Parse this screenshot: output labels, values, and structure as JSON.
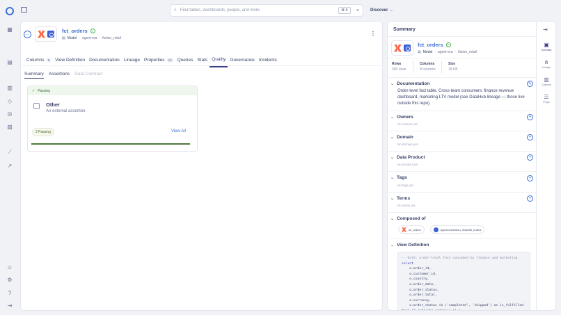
{
  "search": {
    "placeholder": "Find tables, dashboards, people, and more",
    "shortcut": "⌘ K"
  },
  "nav": {
    "discover": "Discover →"
  },
  "entity": {
    "name": "fct_orders",
    "type": "Model",
    "path": [
      "agent-era",
      "fiction_retail"
    ]
  },
  "tabs": [
    {
      "label": "Columns",
      "count": "9"
    },
    {
      "label": "View Definition"
    },
    {
      "label": "Documentation"
    },
    {
      "label": "Lineage"
    },
    {
      "label": "Properties",
      "count": "12"
    },
    {
      "label": "Queries"
    },
    {
      "label": "Stats"
    },
    {
      "label": "Quality"
    },
    {
      "label": "Governance"
    },
    {
      "label": "Incidents"
    }
  ],
  "active_tab": "Quality",
  "subtabs": [
    "Summary",
    "Assertions",
    "Data Contract"
  ],
  "quality": {
    "status": "Passing",
    "group_title": "Other",
    "group_desc": "An external assertion.",
    "badge": "2 Passing",
    "view_all": "View All",
    "progress": 1.0
  },
  "summary": {
    "title": "Summary",
    "entity_name": "fct_orders",
    "entity_type": "Model",
    "path": [
      "agent-era",
      "fiction_retail"
    ],
    "stats": [
      {
        "label": "Rows",
        "value": "300 rows"
      },
      {
        "label": "Columns",
        "value": "8 columns"
      },
      {
        "label": "Size",
        "value": "18 KB"
      }
    ],
    "documentation_title": "Documentation",
    "documentation": "Order-level fact table. Cross-team consumers: finance revenue dashboard, marketing LTV model (see DataHub lineage — those live outside this repo).",
    "sections": [
      {
        "title": "Owners",
        "empty": "No owners yet."
      },
      {
        "title": "Domain",
        "empty": "No domain yet."
      },
      {
        "title": "Data Product",
        "empty": "No product yet."
      },
      {
        "title": "Tags",
        "empty": "No tags yet."
      },
      {
        "title": "Terms",
        "empty": "No terms yet."
      }
    ],
    "composed_of_title": "Composed of",
    "composed_of": [
      "fct_orders",
      "agent-era.fiction_retail.fct_orders"
    ],
    "view_definition_title": "View Definition"
  },
  "side_rail": [
    {
      "label": "Summary"
    },
    {
      "label": "Lineage"
    },
    {
      "label": "Columns"
    },
    {
      "label": "Props"
    }
  ],
  "code_lines": [
    {
      "t": "-- Gold: order-level fact consumed by finance and marketing.",
      "c": "cm"
    },
    {
      "t": "select",
      "c": "kw"
    },
    {
      "t": "    o.order_id,",
      "c": ""
    },
    {
      "t": "    o.customer_id,",
      "c": ""
    },
    {
      "t": "    o.country,",
      "c": ""
    },
    {
      "t": "    o.order_date,",
      "c": ""
    },
    {
      "t": "    o.order_status,",
      "c": ""
    },
    {
      "t": "    o.order_total,",
      "c": ""
    },
    {
      "t": "    o.currency,",
      "c": ""
    },
    {
      "t": "    o.order_status in ('completed', 'shipped') as is_fulfilled",
      "c": ""
    },
    {
      "t": "from {{ ref('stg_orders') }} o",
      "c": ""
    }
  ]
}
